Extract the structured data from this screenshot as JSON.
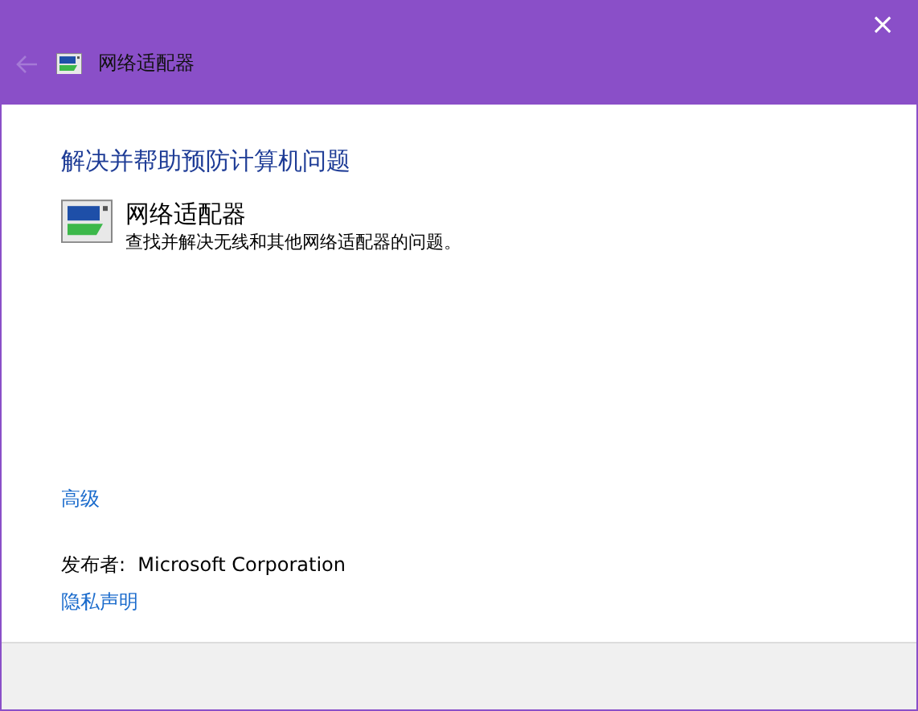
{
  "window": {
    "title": "网络适配器",
    "close": "×",
    "back": {
      "disabled": true
    }
  },
  "heading": "解决并帮助预防计算机问题",
  "troubleshooter": {
    "title": "网络适配器",
    "description": "查找并解决无线和其他网络适配器的问题。"
  },
  "advanced_link": "高级",
  "publisher": "发布者:  Microsoft Corporation",
  "privacy_link": "隐私声明"
}
